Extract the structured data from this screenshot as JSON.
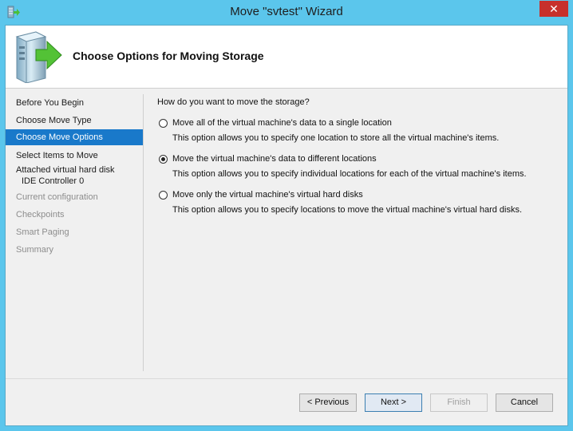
{
  "window": {
    "title": "Move \"svtest\" Wizard",
    "close_glyph": "✕"
  },
  "header": {
    "title": "Choose Options for Moving Storage",
    "icon": "server-move-icon"
  },
  "nav": {
    "items": [
      {
        "label": "Before You Begin",
        "state": "normal"
      },
      {
        "label": "Choose Move Type",
        "state": "normal"
      },
      {
        "label": "Choose Move Options",
        "state": "selected"
      },
      {
        "label": "Select Items to Move",
        "state": "normal"
      },
      {
        "label": "Attached virtual hard disk",
        "sublabel": "IDE Controller 0",
        "state": "normal"
      },
      {
        "label": "Current configuration",
        "state": "disabled"
      },
      {
        "label": "Checkpoints",
        "state": "disabled"
      },
      {
        "label": "Smart Paging",
        "state": "disabled"
      },
      {
        "label": "Summary",
        "state": "disabled"
      }
    ]
  },
  "content": {
    "question": "How do you want to move the storage?",
    "options": [
      {
        "label": "Move all of the virtual machine's data to a single location",
        "description": "This option allows you to specify one location to store all the virtual machine's items.",
        "checked": false
      },
      {
        "label": "Move the virtual machine's data to different locations",
        "description": "This option allows you to specify individual locations for each of the virtual machine's items.",
        "checked": true
      },
      {
        "label": "Move only the virtual machine's virtual hard disks",
        "description": "This option allows you to specify locations to move the virtual machine's virtual hard disks.",
        "checked": false
      }
    ]
  },
  "footer": {
    "previous_label": "< Previous",
    "next_label": "Next >",
    "finish_label": "Finish",
    "cancel_label": "Cancel"
  },
  "colors": {
    "title_bar": "#5bc6ec",
    "close_button": "#c7302b",
    "nav_selected": "#1979ca"
  }
}
